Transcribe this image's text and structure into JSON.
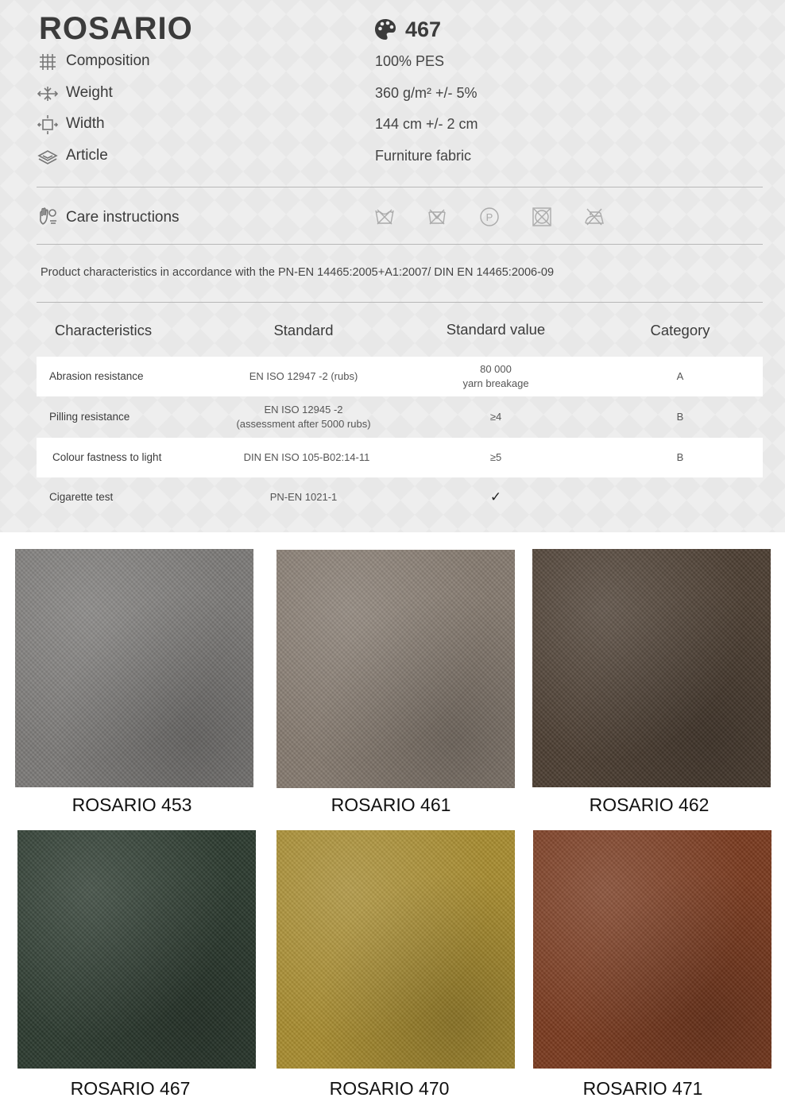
{
  "header": {
    "title": "ROSARIO",
    "color_code": "467"
  },
  "specs": [
    {
      "icon": "composition-icon",
      "label": "Composition",
      "value": "100% PES"
    },
    {
      "icon": "weight-icon",
      "label": "Weight",
      "value": "360 g/m² +/-  5%"
    },
    {
      "icon": "width-icon",
      "label": "Width",
      "value": "144 cm +/-  2 cm"
    },
    {
      "icon": "article-icon",
      "label": "Article",
      "value": "Furniture fabric"
    }
  ],
  "care": {
    "label": "Care instructions",
    "icons": [
      "do-not-wash-icon",
      "do-not-bleach-icon",
      "professional-cleaning-p-icon",
      "do-not-tumble-dry-icon",
      "do-not-iron-icon"
    ]
  },
  "note": "Product characteristics in accordance with the PN-EN 14465:2005+A1:2007/ DIN EN 14465:2006-09",
  "table": {
    "headers": [
      "Characteristics",
      "Standard",
      "Standard value",
      "Category"
    ],
    "rows": [
      {
        "characteristic": "Abrasion resistance",
        "standard": "EN ISO 12947 -2 (rubs)",
        "standard_extra": "",
        "value": "80 000",
        "value_extra": "yarn breakage",
        "category": "A"
      },
      {
        "characteristic": "Pilling resistance",
        "standard": "EN ISO 12945 -2",
        "standard_extra": "(assessment after 5000 rubs)",
        "value": "≥4",
        "value_extra": "",
        "category": "B"
      },
      {
        "characteristic": "Colour fastness to light",
        "standard": "DIN EN ISO 105-B02:14-11",
        "standard_extra": "",
        "value": "≥5",
        "value_extra": "",
        "category": "B"
      },
      {
        "characteristic": "Cigarette test",
        "standard": "PN-EN 1021-1",
        "standard_extra": "",
        "value": "✓",
        "value_extra": "",
        "category": ""
      }
    ]
  },
  "swatches": [
    {
      "label": "ROSARIO 453",
      "color": "#7c7a78"
    },
    {
      "label": "ROSARIO 461",
      "color": "#857a6f"
    },
    {
      "label": "ROSARIO 462",
      "color": "#4c3e32"
    },
    {
      "label": "ROSARIO 467",
      "color": "#2c3a2f"
    },
    {
      "label": "ROSARIO 470",
      "color": "#a88c30"
    },
    {
      "label": "ROSARIO 471",
      "color": "#7a3a1f"
    }
  ]
}
